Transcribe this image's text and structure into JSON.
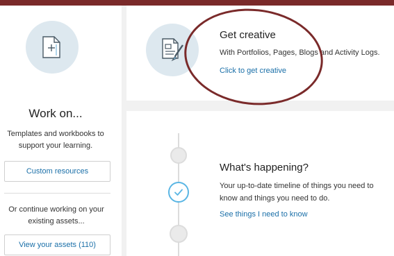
{
  "left_panel": {
    "title": "Work on...",
    "description": "Templates and workbooks to support your learning.",
    "custom_button": "Custom resources",
    "continue_text": "Or continue working on your existing assets...",
    "assets_button": "View your assets (110)"
  },
  "creative_card": {
    "title": "Get creative",
    "description": "With Portfolios, Pages, Blogs and Activity Logs.",
    "link": "Click to get creative"
  },
  "happening_card": {
    "title": "What's happening?",
    "description": "Your up-to-date timeline of things you need to know and things you need to do.",
    "link": "See things I need to know"
  },
  "icons": {
    "left_panel": "add-document-icon",
    "creative_card": "document-brush-icon",
    "timeline_current": "check-icon"
  },
  "colors": {
    "accent_bar": "#7a2a2a",
    "link": "#1a6fa8",
    "icon_circle": "#dde8ef",
    "check": "#5ab6e4"
  }
}
